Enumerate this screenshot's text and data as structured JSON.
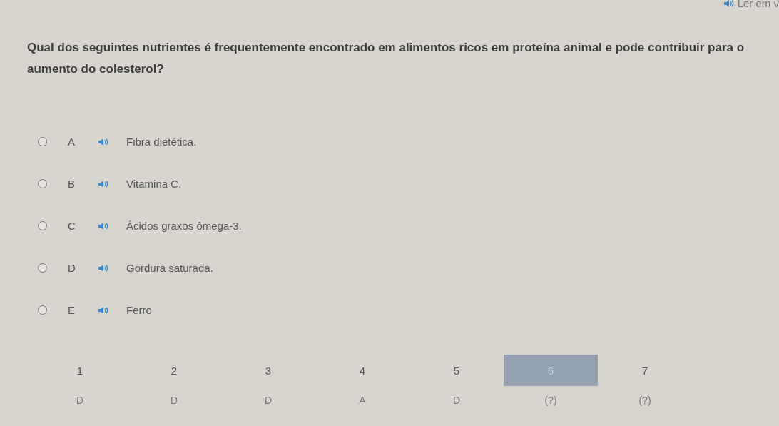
{
  "header": {
    "read_aloud": "Ler em v"
  },
  "question": "Qual dos seguintes nutrientes é frequentemente encontrado em alimentos ricos em proteína animal e pode contribuir para o aumento do colesterol?",
  "options": [
    {
      "letter": "A",
      "text": "Fibra dietética.",
      "selected": false
    },
    {
      "letter": "B",
      "text": "Vitamina C.",
      "selected": false
    },
    {
      "letter": "C",
      "text": "Ácidos graxos ômega-3.",
      "selected": false
    },
    {
      "letter": "D",
      "text": "Gordura saturada.",
      "selected": false
    },
    {
      "letter": "E",
      "text": "Ferro",
      "selected": false
    }
  ],
  "navigator": [
    {
      "number": "1",
      "answer": "D",
      "selected": false
    },
    {
      "number": "2",
      "answer": "D",
      "selected": false
    },
    {
      "number": "3",
      "answer": "D",
      "selected": false
    },
    {
      "number": "4",
      "answer": "A",
      "selected": false
    },
    {
      "number": "5",
      "answer": "D",
      "selected": false
    },
    {
      "number": "6",
      "answer": "(?)",
      "selected": true
    },
    {
      "number": "7",
      "answer": "(?)",
      "selected": false
    }
  ]
}
